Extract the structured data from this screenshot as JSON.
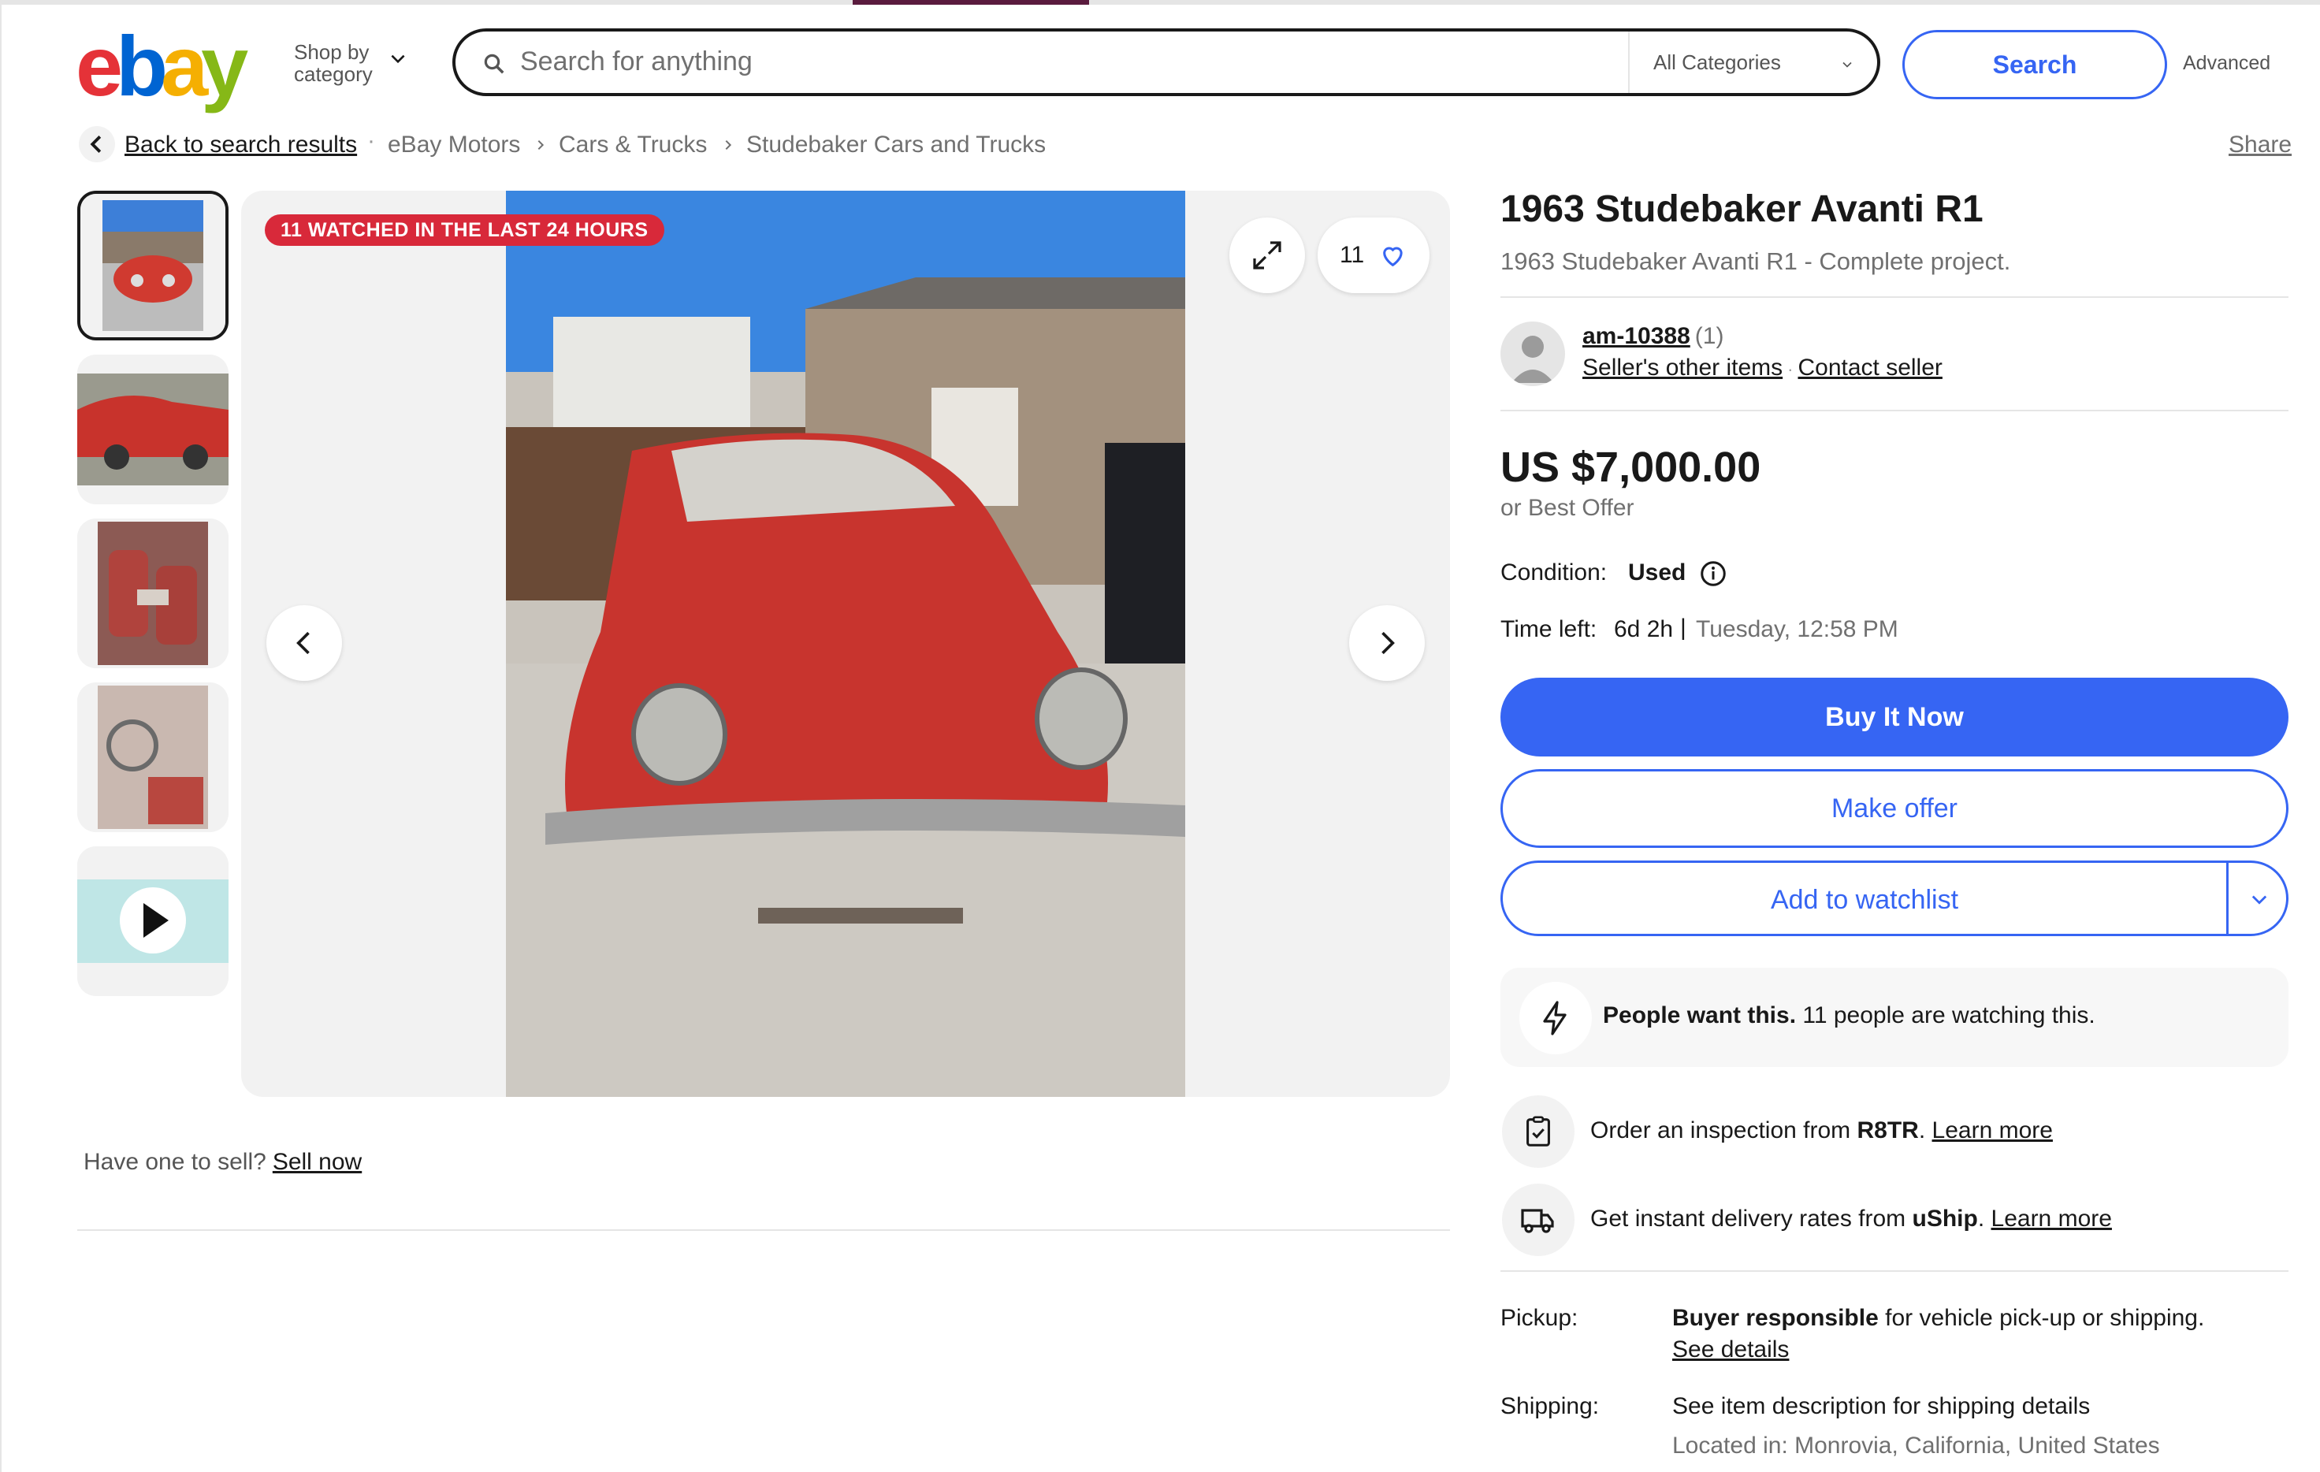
{
  "brand": {
    "letters": [
      {
        "char": "e",
        "color": "#e53238"
      },
      {
        "char": "b",
        "color": "#0064d2"
      },
      {
        "char": "a",
        "color": "#f5af02"
      },
      {
        "char": "y",
        "color": "#86b817"
      }
    ]
  },
  "header": {
    "shop_by_line1": "Shop by",
    "shop_by_line2": "category",
    "search_placeholder": "Search for anything",
    "category_selected": "All Categories",
    "search_button": "Search",
    "advanced": "Advanced"
  },
  "breadcrumb": {
    "back": "Back to search results",
    "items": [
      "eBay Motors",
      "Cars & Trucks",
      "Studebaker Cars and Trucks"
    ],
    "share": "Share"
  },
  "gallery": {
    "watched_badge": "11 WATCHED IN THE LAST 24 HOURS",
    "watch_count": "11",
    "thumbnail_count": 5,
    "selected_thumbnail": 1
  },
  "sell": {
    "prompt": "Have one to sell?",
    "link": "Sell now"
  },
  "item": {
    "title": "1963 Studebaker Avanti R1",
    "subtitle": "1963 Studebaker Avanti R1 - Complete project."
  },
  "seller": {
    "name": "am-10388",
    "feedback": "(1)",
    "other_items": "Seller's other items",
    "contact": "Contact seller"
  },
  "price": {
    "amount": "US $7,000.00",
    "best_offer": "or Best Offer"
  },
  "condition": {
    "label": "Condition:",
    "value": "Used"
  },
  "time_left": {
    "label": "Time left:",
    "value": "6d 2h",
    "separator": "|",
    "end": "Tuesday, 12:58 PM"
  },
  "actions": {
    "buy_now": "Buy It Now",
    "make_offer": "Make offer",
    "add_watchlist": "Add to watchlist"
  },
  "people": {
    "bold": "People want this.",
    "rest": "11 people are watching this."
  },
  "inspection": {
    "text": "Order an inspection from",
    "provider": "R8TR",
    "period": ".",
    "link": "Learn more"
  },
  "delivery": {
    "text": "Get instant delivery rates from",
    "provider": "uShip",
    "period": ".",
    "link": "Learn more"
  },
  "pickup": {
    "label": "Pickup:",
    "bold": "Buyer responsible",
    "rest": "for vehicle pick-up or shipping.",
    "link": "See details"
  },
  "shipping": {
    "label": "Shipping:",
    "value": "See item description for shipping details",
    "located": "Located in: Monrovia, California, United States"
  },
  "colors": {
    "accent": "#3665f3",
    "badge": "#d8293a",
    "text": "#191919",
    "muted": "#707070"
  }
}
